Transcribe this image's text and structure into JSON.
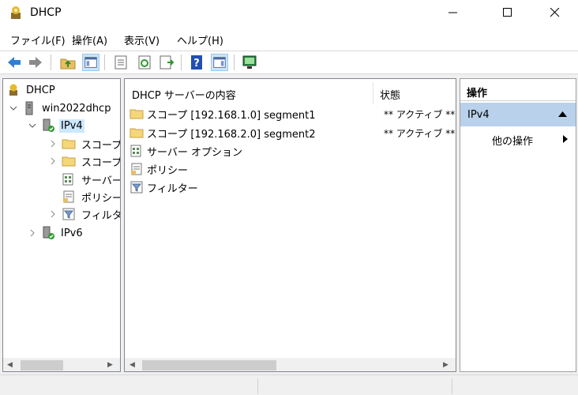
{
  "window": {
    "title": "DHCP"
  },
  "menu": [
    "ファイル(F)",
    "操作(A)",
    "表示(V)",
    "ヘルプ(H)"
  ],
  "tree": {
    "root": "DHCP",
    "server": "win2022dhcp",
    "ipv4": "IPv4",
    "children": [
      "スコープ",
      "スコープ",
      "サーバー",
      "ポリシー",
      "フィルター"
    ],
    "ipv6": "IPv6"
  },
  "content": {
    "col_name": "DHCP サーバーの内容",
    "col_status": "状態",
    "rows": [
      {
        "name": "スコープ [192.168.1.0] segment1",
        "status": "** アクティブ **",
        "icon": "folder-icon"
      },
      {
        "name": "スコープ [192.168.2.0] segment2",
        "status": "** アクティブ **",
        "icon": "folder-icon"
      },
      {
        "name": "サーバー オプション",
        "status": "",
        "icon": "server-options-icon"
      },
      {
        "name": "ポリシー",
        "status": "",
        "icon": "policy-icon"
      },
      {
        "name": "フィルター",
        "status": "",
        "icon": "filter-icon"
      }
    ]
  },
  "actions": {
    "title": "操作",
    "group": "IPv4",
    "item": "他の操作"
  },
  "colors": {
    "selected": "#cce8ff",
    "action_group": "#b9d1ea",
    "accent": "#0078d7"
  }
}
